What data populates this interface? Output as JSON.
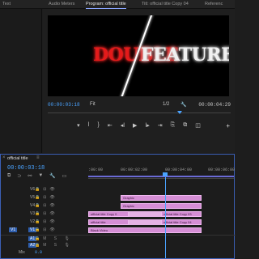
{
  "tabs": [
    {
      "label": "Text"
    },
    {
      "label": "Audio Meters"
    },
    {
      "label": "Program: official title"
    },
    {
      "label": "Titl: official title Copy 04"
    },
    {
      "label": "Referenc"
    }
  ],
  "program": {
    "title_left": "DOUBLE",
    "title_right": "FEATURE",
    "current_timecode": "00:00:03:18",
    "fit": "Fit",
    "resolution": "1/2",
    "duration": "00:00:04:29"
  },
  "transport": {
    "buttons": [
      "mark-in",
      "mark-out",
      "go-to-in",
      "step-back",
      "play",
      "step-forward",
      "go-to-out",
      "insert",
      "overwrite",
      "export-frame"
    ]
  },
  "timeline": {
    "sequence_tab": "official title",
    "timecode": "00:00:03:18",
    "ruler_ticks": [
      ":00:00",
      "00:00:02:00",
      "00:00:04:00",
      "00:00:06:00"
    ],
    "video_tracks": [
      "V6",
      "V5",
      "V4",
      "V3",
      "V2",
      "V1"
    ],
    "audio_tracks": [
      "A1",
      "A2",
      "A3",
      "A4",
      "A5",
      "A6"
    ],
    "mix_label": "Mix",
    "mix_value": "0.0",
    "clips": [
      {
        "name": "Graphic",
        "track": "V5"
      },
      {
        "name": "Graphic",
        "track": "V4"
      },
      {
        "name": "official title Copy 0",
        "track": "V3"
      },
      {
        "name": "official title Copy 03",
        "track": "V3"
      },
      {
        "name": "official title",
        "track": "V2"
      },
      {
        "name": "official title Copy 04",
        "track": "V2"
      },
      {
        "name": "Black Video",
        "track": "V1"
      }
    ]
  }
}
